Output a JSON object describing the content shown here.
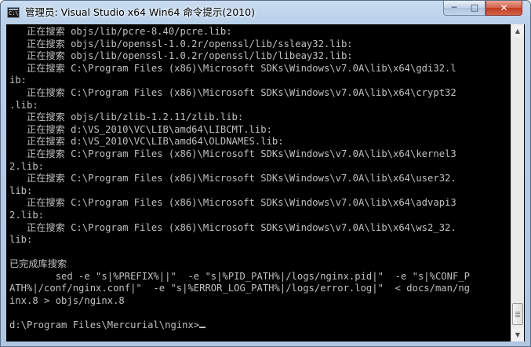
{
  "window": {
    "title": "管理员: Visual Studio x64 Win64 命令提示(2010)",
    "icon": "console-icon",
    "controls": {
      "minimize": "─",
      "maximize": "□",
      "close": "✕"
    }
  },
  "console": {
    "text_color": "#c0c0c0",
    "background": "#000000",
    "lines": [
      "   正在搜索 objs/lib/pcre-8.40/pcre.lib:",
      "   正在搜索 objs/lib/openssl-1.0.2r/openssl/lib/ssleay32.lib:",
      "   正在搜索 objs/lib/openssl-1.0.2r/openssl/lib/libeay32.lib:",
      "   正在搜索 C:\\Program Files (x86)\\Microsoft SDKs\\Windows\\v7.0A\\lib\\x64\\gdi32.l",
      "ib:",
      "   正在搜索 C:\\Program Files (x86)\\Microsoft SDKs\\Windows\\v7.0A\\lib\\x64\\crypt32",
      ".lib:",
      "   正在搜索 objs/lib/zlib-1.2.11/zlib.lib:",
      "   正在搜索 d:\\VS_2010\\VC\\LIB\\amd64\\LIBCMT.lib:",
      "   正在搜索 d:\\VS_2010\\VC\\LIB\\amd64\\OLDNAMES.lib:",
      "   正在搜索 C:\\Program Files (x86)\\Microsoft SDKs\\Windows\\v7.0A\\lib\\x64\\kernel3",
      "2.lib:",
      "   正在搜索 C:\\Program Files (x86)\\Microsoft SDKs\\Windows\\v7.0A\\lib\\x64\\user32.",
      "lib:",
      "   正在搜索 C:\\Program Files (x86)\\Microsoft SDKs\\Windows\\v7.0A\\lib\\x64\\advapi3",
      "2.lib:",
      "   正在搜索 C:\\Program Files (x86)\\Microsoft SDKs\\Windows\\v7.0A\\lib\\x64\\ws2_32.",
      "lib:",
      "",
      "已完成库搜索",
      "        sed -e \"s|%PREFIX%||\"  -e \"s|%PID_PATH%|/logs/nginx.pid|\"  -e \"s|%CONF_P",
      "ATH%|/conf/nginx.conf|\"  -e \"s|%ERROR_LOG_PATH%|/logs/error.log|\"  < docs/man/ng",
      "inx.8 > objs/nginx.8",
      ""
    ],
    "prompt": "d:\\Program Files\\Mercurial\\nginx>"
  },
  "scrollbar": {
    "up_icon": "▲",
    "down_icon": "▼",
    "position": 0.93
  }
}
